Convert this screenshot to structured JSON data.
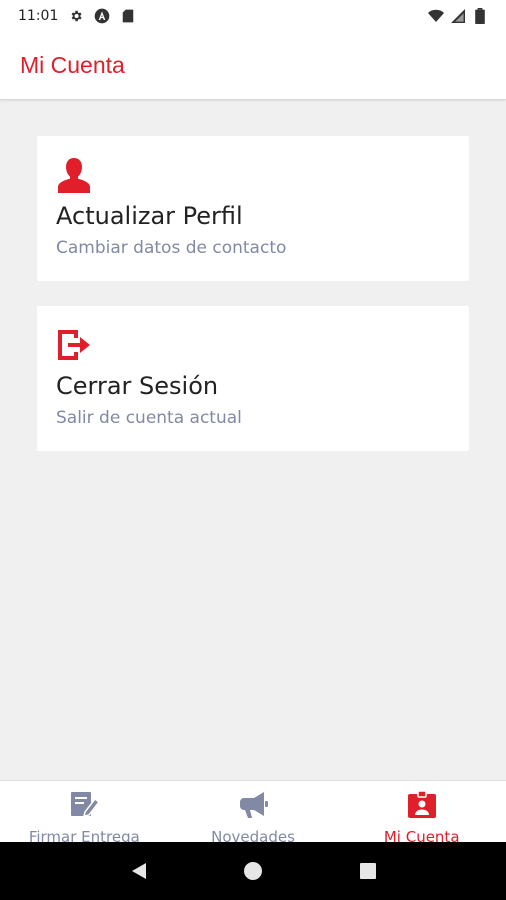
{
  "status_bar": {
    "time": "11:01",
    "icons_left": [
      "gear-icon",
      "a-circle-icon",
      "sd-card-icon"
    ],
    "icons_right": [
      "wifi-icon",
      "signal-icon",
      "battery-icon"
    ]
  },
  "app_bar": {
    "title": "Mi Cuenta"
  },
  "cards": [
    {
      "icon": "user-icon",
      "title": "Actualizar Perfil",
      "subtitle": "Cambiar datos de contacto"
    },
    {
      "icon": "logout-icon",
      "title": "Cerrar Sesión",
      "subtitle": "Salir de cuenta actual"
    }
  ],
  "bottom_nav": {
    "items": [
      {
        "icon": "signature-icon",
        "label": "Firmar Entrega",
        "active": false
      },
      {
        "icon": "megaphone-icon",
        "label": "Novedades",
        "active": false
      },
      {
        "icon": "id-badge-icon",
        "label": "Mi Cuenta",
        "active": true
      }
    ]
  },
  "system_nav": {
    "buttons": [
      "back-icon",
      "home-icon",
      "recents-icon"
    ]
  },
  "colors": {
    "accent": "#e01f2b",
    "muted": "#8189a4",
    "background": "#f0f0f0",
    "card": "#ffffff"
  }
}
